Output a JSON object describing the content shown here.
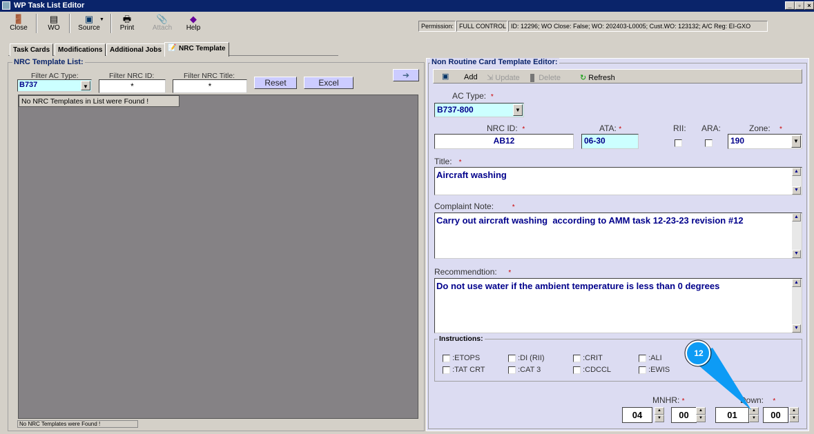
{
  "window": {
    "title": "WP Task List Editor",
    "minimize": "_",
    "restore": "▫",
    "close": "×"
  },
  "toolbar": {
    "close": "Close",
    "wo": "WO",
    "source": "Source",
    "print": "Print",
    "attach": "Attach",
    "help": "Help"
  },
  "status": {
    "permission_label": "Permission:",
    "permission_value": "FULL CONTROL",
    "info": "ID: 12296; WO Close: False; WO: 202403-L0005; Cust.WO: 123132; A/C Reg: EI-GXO"
  },
  "tabs": [
    "Task Cards",
    "Modifications",
    "Additional Jobs",
    "NRC Template"
  ],
  "list": {
    "legend": "NRC Template List:",
    "filter_ac_label": "Filter AC Type:",
    "filter_ac_value": "B737",
    "filter_id_label": "Filter NRC ID:",
    "filter_id_value": "*",
    "filter_title_label": "Filter NRC Title:",
    "filter_title_value": "*",
    "reset": "Reset",
    "excel": "Excel",
    "empty_msg": "No NRC Templates in List were Found !",
    "status_msg": "No NRC Templates were Found !"
  },
  "editor": {
    "legend": "Non Routine Card Template Editor:",
    "add": "Add",
    "update": "Update",
    "delete": "Delete",
    "refresh": "Refresh",
    "ac_type_label": "AC Type:",
    "ac_type_value": "B737-800",
    "nrc_id_label": "NRC ID:",
    "nrc_id_value": "AB12",
    "ata_label": "ATA:",
    "ata_value": "06-30",
    "rii_label": "RII:",
    "ara_label": "ARA:",
    "zone_label": "Zone:",
    "zone_value": "190",
    "title_label": "Title:",
    "title_value": "Aircraft washing",
    "complaint_label": "Complaint Note:",
    "complaint_value": "Carry out aircraft washing  according to AMM task 12-23-23 revision #12",
    "recommendation_label": "Recommendtion:",
    "recommendation_value": "Do not use water if the ambient temperature is less than 0 degrees",
    "instructions_legend": "Instructions:",
    "instructions": [
      ":ETOPS",
      ":DI (RII)",
      ":CRIT",
      ":ALI",
      ":TAT CRT",
      ":CAT 3",
      ":CDCCL",
      ":EWIS"
    ],
    "mnhr_label": "MNHR:",
    "down_label": "Down:",
    "mnhr_h": "04",
    "mnhr_m": "00",
    "down_h": "01",
    "down_m": "00",
    "required": "*"
  },
  "callout": {
    "number": "12"
  }
}
